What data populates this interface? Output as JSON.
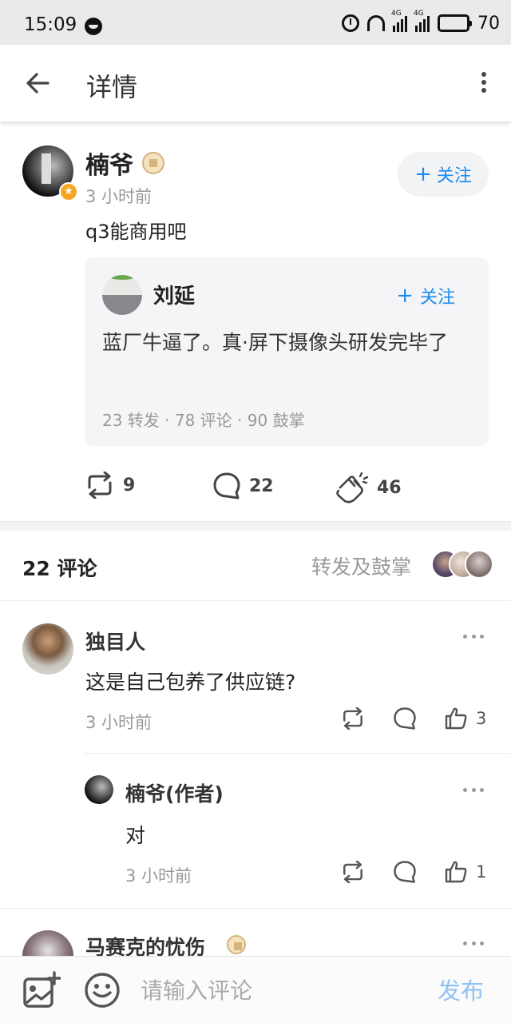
{
  "status_bar": {
    "time": "15:09",
    "battery": "70",
    "network": "4G"
  },
  "header": {
    "title": "详情"
  },
  "post": {
    "author": "楠爷",
    "time": "3 小时前",
    "follow_label": "关注",
    "text": "q3能商用吧",
    "quote": {
      "author": "刘延",
      "follow_label": "关注",
      "text": "蓝厂牛逼了。真·屏下摄像头研发完毕了",
      "stats": "23 转发 · 78 评论 · 90 鼓掌"
    },
    "actions": {
      "reposts": "9",
      "comments": "22",
      "claps": "46"
    }
  },
  "comments_header": {
    "count_label": "22 评论",
    "reposts_link": "转发及鼓掌"
  },
  "comments": [
    {
      "author": "独目人",
      "text": "这是自己包养了供应链?",
      "time": "3 小时前",
      "likes": "3",
      "reply": {
        "author": "楠爷(作者)",
        "text": "对",
        "time": "3 小时前",
        "likes": "1"
      }
    },
    {
      "author": "马赛克的忧伤"
    }
  ],
  "input_bar": {
    "placeholder": "请输入评论",
    "publish_label": "发布"
  },
  "colors": {
    "accent": "#1a8bf0",
    "publish_disabled": "#8fc3f4",
    "badge": "#f5a623"
  }
}
